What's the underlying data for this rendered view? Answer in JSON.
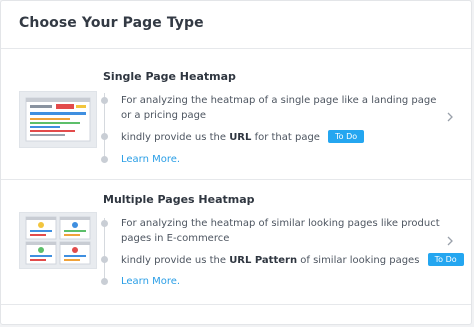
{
  "header": {
    "title": "Choose Your Page Type"
  },
  "options": [
    {
      "title": "Single Page Heatmap",
      "description": "For analyzing the heatmap of a single page like a landing page or a pricing page",
      "instruction_before": "kindly provide us the ",
      "instruction_bold": "URL",
      "instruction_after": " for that page",
      "badge": "To Do",
      "learn_more": "Learn More.",
      "icon": "chevron-right-icon"
    },
    {
      "title": "Multiple Pages Heatmap",
      "description": "For analyzing the heatmap of similar looking pages like product pages in E-commerce",
      "instruction_before": "kindly provide us the ",
      "instruction_bold": "URL Pattern",
      "instruction_after": " of similar looking pages",
      "badge": "To Do",
      "learn_more": "Learn More.",
      "icon": "chevron-right-icon"
    }
  ],
  "colors": {
    "accent": "#24a6f0",
    "link": "#2a9ee6",
    "text": "#3b4149"
  }
}
